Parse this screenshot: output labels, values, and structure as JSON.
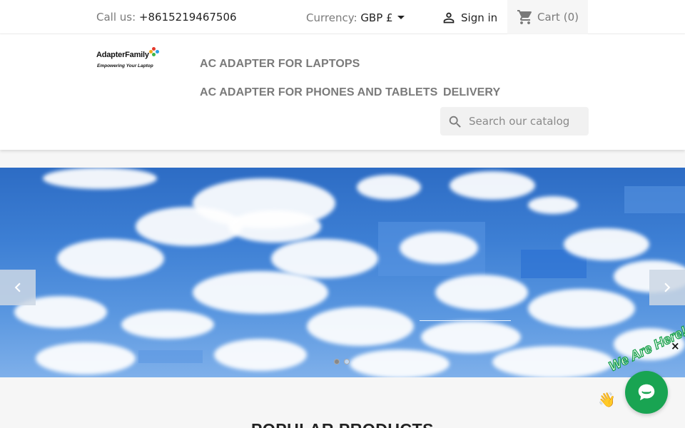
{
  "topbar": {
    "contact_label": "Call us: ",
    "phone": "+8615219467506",
    "currency_label": "Currency: ",
    "currency_value": "GBP £",
    "signin_label": "Sign in",
    "cart_label": "Cart",
    "cart_count": "(0)"
  },
  "logo": {
    "name": "AdapterFamily",
    "tagline": "Empowering Your Laptop"
  },
  "menu": {
    "items": [
      {
        "label": "AC ADAPTER FOR LAPTOPS"
      },
      {
        "label": "AC ADAPTER FOR PHONES AND TABLETS"
      },
      {
        "label": "DELIVERY"
      }
    ]
  },
  "search": {
    "placeholder": "Search our catalog"
  },
  "slider": {
    "slide_count": 2,
    "active_slide": 1
  },
  "popular": {
    "heading": "POPULAR PRODUCTS"
  },
  "chat": {
    "tag": "We Are Here!",
    "close": "×"
  },
  "colors": {
    "accent_green": "#19a452",
    "text_dark": "#232323",
    "text_muted": "#7a7a7a"
  }
}
